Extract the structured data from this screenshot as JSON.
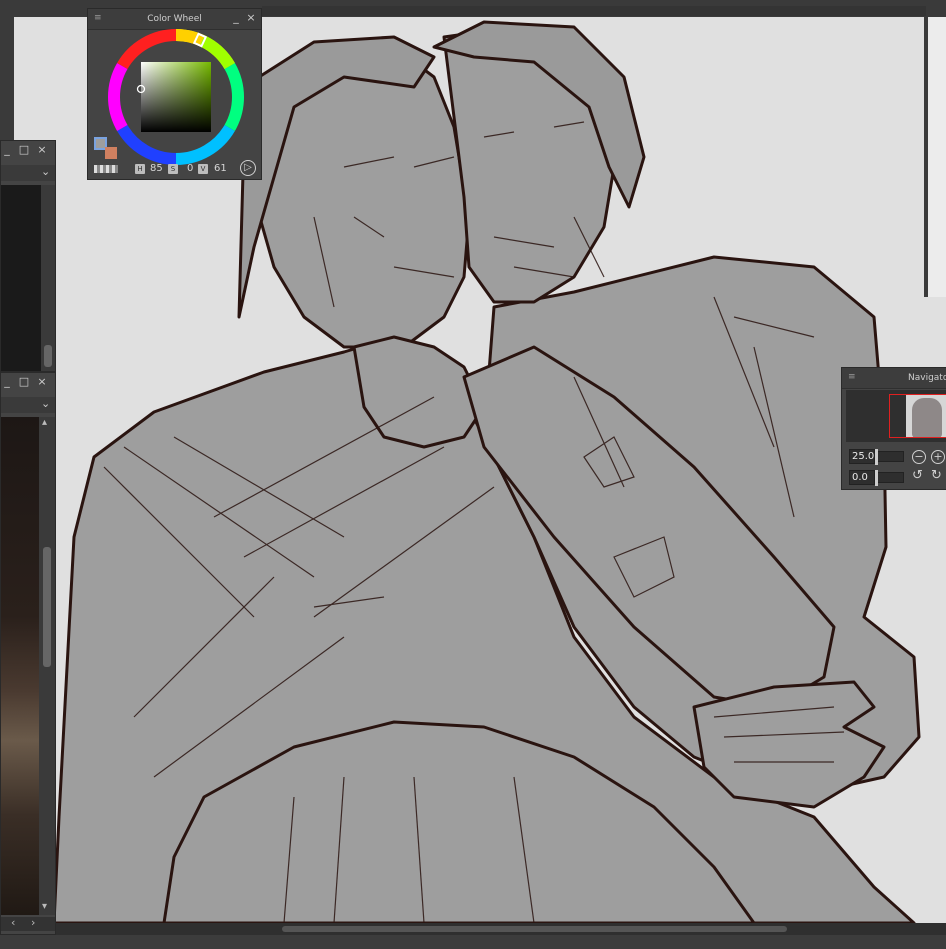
{
  "color_wheel": {
    "title": "Color Wheel",
    "minimize_glyph": "_",
    "close_glyph": "×",
    "hsv": {
      "h_label": "H",
      "h": "85",
      "s_label": "S",
      "s": "0",
      "v_label": "V",
      "v": "61"
    },
    "play_glyph": "▷",
    "square_base_color": "#76b900"
  },
  "navigator": {
    "title": "Navigato",
    "zoom": "25.0",
    "rotation": "0.0",
    "zoom_out_glyph": "−",
    "zoom_in_glyph": "+",
    "rotate_left_glyph": "↺",
    "rotate_right_glyph": "↻"
  },
  "left_panel_top": {
    "minimize_glyph": "_",
    "maximize_glyph": "□",
    "close_glyph": "×",
    "dropdown_glyph": "⌄"
  },
  "left_panel_bottom": {
    "minimize_glyph": "_",
    "maximize_glyph": "□",
    "close_glyph": "×",
    "dropdown_glyph": "⌄",
    "scroll_up_glyph": "▴",
    "scroll_down_glyph": "▾",
    "scroll_left_glyph": "‹",
    "scroll_right_glyph": "›"
  },
  "colors": {
    "canvas_bg": "#e0e0e0",
    "fill_gray": "#9e9e9e",
    "line_dark": "#2a1410",
    "panel_bg": "#444444",
    "nav_frame": "#e02020"
  }
}
